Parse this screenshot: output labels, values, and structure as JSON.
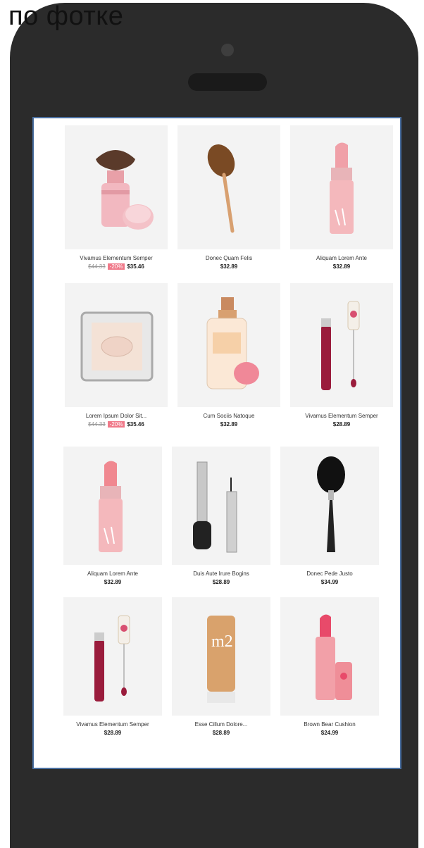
{
  "caption": "по фотке",
  "products_top": [
    {
      "name": "Vivamus Elementum Semper",
      "old_price": "$44.33",
      "discount": "-20%",
      "price": "$35.46",
      "icon": "kabuki-brush"
    },
    {
      "name": "Donec Quam Felis",
      "old_price": "",
      "discount": "",
      "price": "$32.89",
      "icon": "oval-brush"
    },
    {
      "name": "Aliquam Lorem Ante",
      "old_price": "",
      "discount": "",
      "price": "$32.89",
      "icon": "lipstick"
    },
    {
      "name": "Lorem Ipsum Dolor Sit...",
      "old_price": "$44.33",
      "discount": "-20%",
      "price": "$35.46",
      "icon": "compact-powder"
    },
    {
      "name": "Cum Sociis Natoque",
      "old_price": "",
      "discount": "",
      "price": "$32.89",
      "icon": "spray-bottle"
    },
    {
      "name": "Vivamus Elementum Semper",
      "old_price": "",
      "discount": "",
      "price": "$28.89",
      "icon": "lip-gloss"
    }
  ],
  "products_bottom": [
    {
      "name": "Aliquam Lorem Ante",
      "price": "$32.89",
      "icon": "lipstick"
    },
    {
      "name": "Duis Aute Irure Bogins",
      "price": "$28.89",
      "icon": "eyeliner"
    },
    {
      "name": "Donec Pede Justo",
      "price": "$34.99",
      "icon": "powder-brush"
    },
    {
      "name": "Vivamus Elementum Semper",
      "price": "$28.89",
      "icon": "lip-gloss"
    },
    {
      "name": "Esse Cillum Dolore...",
      "price": "$28.89",
      "icon": "foundation-bottle"
    },
    {
      "name": "Brown Bear Cushion",
      "price": "$24.99",
      "icon": "lip-balm"
    }
  ],
  "colors": {
    "phone": "#2b2b2b",
    "screen_border": "#4a6fa0",
    "discount": "#f07a8a"
  }
}
